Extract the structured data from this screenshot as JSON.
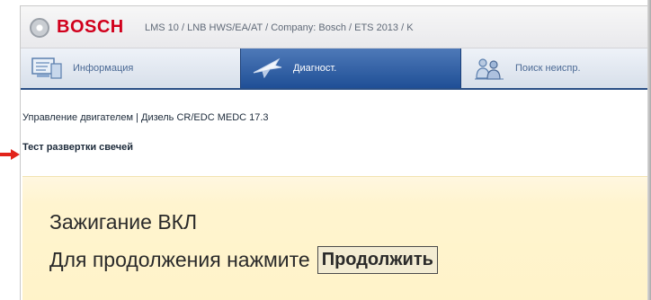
{
  "window": {
    "brand": "BOSCH",
    "title": "LMS 10 / LNB HWS/EA/AT / Company: Bosch / ETS 2013 / K"
  },
  "nav": {
    "tabs": [
      {
        "label": "Информация",
        "icon": "info-monitor-icon",
        "active": false
      },
      {
        "label": "Диагност.",
        "icon": "diagnostics-airplane-icon",
        "active": true
      },
      {
        "label": "Поиск неиспр.",
        "icon": "search-people-icon",
        "active": false
      }
    ]
  },
  "breadcrumb": {
    "path": "Управление двигателем | Дизель CR/EDC MEDC 17.3",
    "test": "Тест развертки свечей"
  },
  "panel": {
    "title": "Зажигание ВКЛ",
    "prompt": "Для продолжения нажмите",
    "continue_label": "Продолжить"
  },
  "colors": {
    "brand_red": "#d1001c",
    "active_tab": "#1f4f96",
    "panel_bg": "#fff3c9",
    "pointer_arrow": "#e2231a"
  }
}
